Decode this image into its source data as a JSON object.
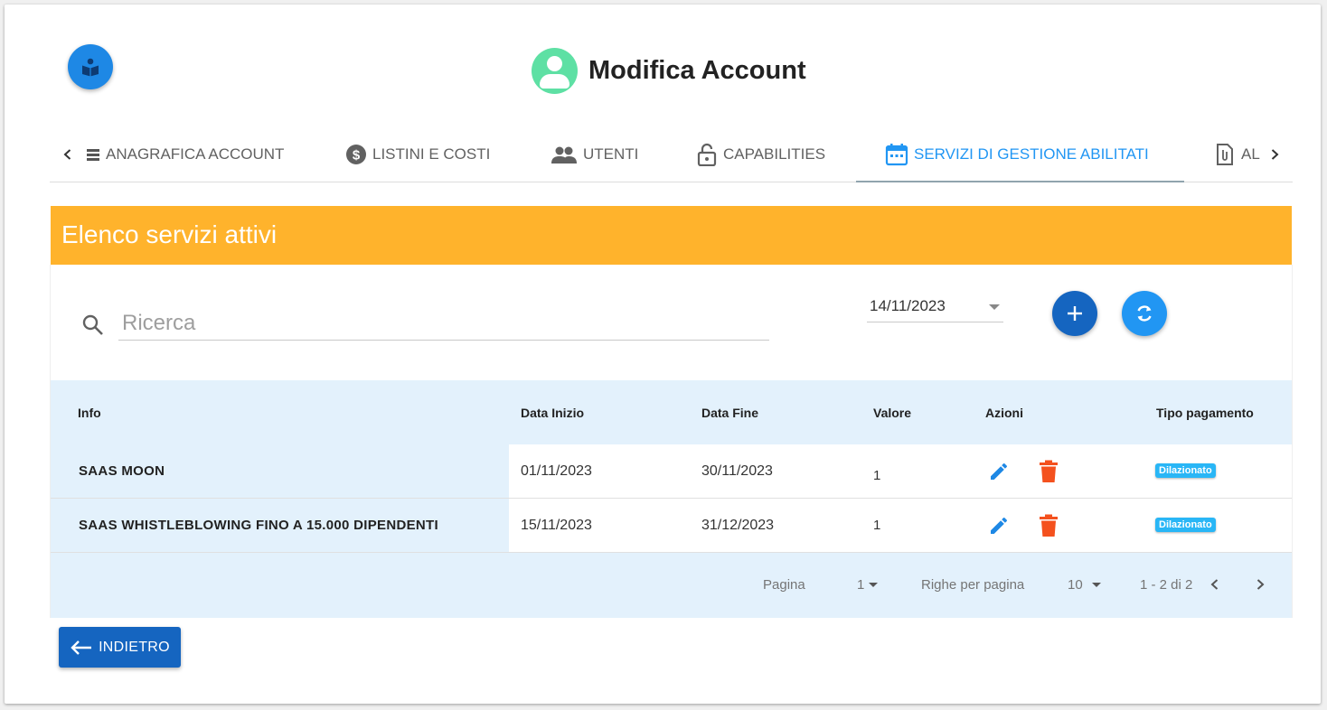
{
  "header": {
    "title": "Modifica Account"
  },
  "tabs": [
    {
      "label": "ANAGRAFICA ACCOUNT",
      "icon": "list-icon"
    },
    {
      "label": "LISTINI E COSTI",
      "icon": "dollar-circle-icon"
    },
    {
      "label": "UTENTI",
      "icon": "people-icon"
    },
    {
      "label": "CAPABILITIES",
      "icon": "lock-open-icon"
    },
    {
      "label": "SERVIZI DI GESTIONE ABILITATI",
      "icon": "calendar-icon",
      "active": true
    },
    {
      "label": "AL",
      "icon": "document-clip-icon"
    }
  ],
  "section": {
    "title": "Elenco servizi attivi"
  },
  "search": {
    "placeholder": "Ricerca",
    "value": ""
  },
  "date_filter": {
    "value": "14/11/2023"
  },
  "table": {
    "headers": [
      "Info",
      "Data Inizio",
      "Data Fine",
      "Valore",
      "Azioni",
      "Tipo pagamento"
    ],
    "rows": [
      {
        "info": "SAAS MOON",
        "start": "01/11/2023",
        "end": "30/11/2023",
        "value": "1",
        "payment": "Dilazionato"
      },
      {
        "info": "SAAS WHISTLEBLOWING FINO A 15.000 DIPENDENTI",
        "start": "15/11/2023",
        "end": "31/12/2023",
        "value": "1",
        "payment": "Dilazionato"
      }
    ]
  },
  "pagination": {
    "page_label": "Pagina",
    "page_value": "1",
    "rows_label": "Righe per pagina",
    "rows_value": "10",
    "range": "1 - 2 di 2"
  },
  "back_button": {
    "label": "INDIETRO"
  },
  "colors": {
    "primary": "#1565c0",
    "accent": "#2196f3",
    "header_bar": "#ffb32c",
    "avatar": "#5ee0a4",
    "delete": "#f4511e",
    "badge": "#29b6f6",
    "row_tint": "#e3f1fc"
  }
}
